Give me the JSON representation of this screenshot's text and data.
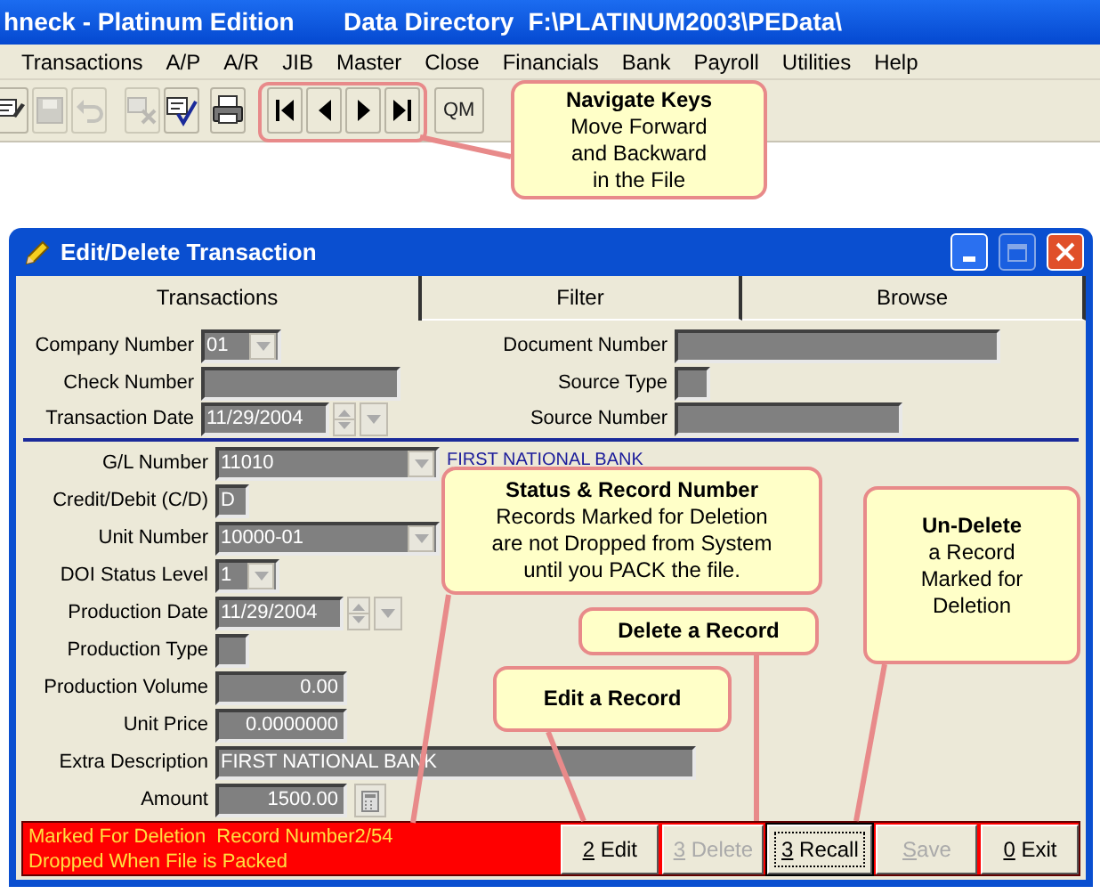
{
  "app_bar": {
    "title": "hneck - Platinum Edition",
    "directory_label": "Data Directory",
    "directory_path": "F:\\PLATINUM2003\\PEData\\"
  },
  "menu": [
    "Transactions",
    "A/P",
    "A/R",
    "JIB",
    "Master",
    "Close",
    "Financials",
    "Bank",
    "Payroll",
    "Utilities",
    "Help"
  ],
  "toolbar": [
    {
      "kind": "edit",
      "disabled": false
    },
    {
      "kind": "save",
      "disabled": true
    },
    {
      "kind": "undo",
      "disabled": true
    },
    {
      "kind": "cut",
      "disabled": true
    },
    {
      "kind": "check",
      "disabled": false
    },
    {
      "kind": "print",
      "disabled": false
    },
    {
      "kind": "first",
      "disabled": false
    },
    {
      "kind": "prev",
      "disabled": false
    },
    {
      "kind": "next",
      "disabled": false
    },
    {
      "kind": "last",
      "disabled": false
    },
    {
      "kind": "text",
      "label": "QM",
      "disabled": false
    }
  ],
  "dialog": {
    "title": "Edit/Delete Transaction",
    "window_buttons": [
      {
        "kind": "minimize",
        "disabled": false
      },
      {
        "kind": "maximize",
        "disabled": true
      },
      {
        "kind": "close",
        "disabled": false
      }
    ],
    "tabs": [
      {
        "label": "Transactions",
        "selected": true
      },
      {
        "label": "Filter",
        "selected": false
      },
      {
        "label": "Browse",
        "selected": false
      }
    ],
    "header_left": [
      {
        "label": "Company Number",
        "kind": "dropdown",
        "value": "01"
      },
      {
        "label": "Check Number",
        "kind": "text"
      },
      {
        "label": "Transaction Date",
        "kind": "date",
        "value": "11/29/2004"
      }
    ],
    "header_right": [
      {
        "label": "Document Number",
        "kind": "text"
      },
      {
        "label": "Source Type",
        "kind": "text"
      },
      {
        "label": "Source Number",
        "kind": "text"
      }
    ],
    "detail_fields": [
      {
        "label": "G/L Number",
        "kind": "dropdown",
        "value": "11010",
        "description": "FIRST NATIONAL BANK"
      },
      {
        "label": "Credit/Debit (C/D)",
        "kind": "text",
        "value": "D"
      },
      {
        "label": "Unit Number",
        "kind": "dropdown",
        "value": "10000-01"
      },
      {
        "label": "DOI Status Level",
        "kind": "dropdown",
        "value": "1"
      },
      {
        "label": "Production Date",
        "kind": "date",
        "value": "11/29/2004"
      },
      {
        "label": "Production Type",
        "kind": "text"
      },
      {
        "label": "Production Volume",
        "kind": "number",
        "value": "0.00"
      },
      {
        "label": "Unit Price",
        "kind": "number",
        "value": "0.0000000"
      },
      {
        "label": "Extra Description",
        "kind": "text",
        "value": "FIRST NATIONAL BANK"
      },
      {
        "label": "Amount",
        "kind": "calc",
        "value": "1500.00"
      }
    ],
    "status": {
      "lines": [
        "Marked For Deletion",
        "Dropped When File is Packed"
      ],
      "record": "Record Number2/54"
    },
    "buttons": [
      {
        "label": "2 Edit",
        "disabled": false,
        "focused": false
      },
      {
        "label": "3 Delete",
        "disabled": true,
        "focused": false
      },
      {
        "label": "3 Recall",
        "disabled": false,
        "focused": true
      },
      {
        "label": "Save",
        "disabled": true,
        "focused": false
      },
      {
        "label": "0 Exit",
        "disabled": false,
        "focused": false
      }
    ]
  },
  "callouts": [
    {
      "title": "Navigate Keys",
      "body": "Move Forward\nand Backward\nin the File"
    },
    {
      "title": "Status & Record Number",
      "body": "Records Marked for Deletion\nare not Dropped from System\nuntil you PACK the file."
    },
    {
      "title": "Un-Delete",
      "body": "a Record\nMarked for\nDeletion"
    },
    {
      "title": "Delete a Record"
    },
    {
      "title": "Edit a Record"
    }
  ]
}
